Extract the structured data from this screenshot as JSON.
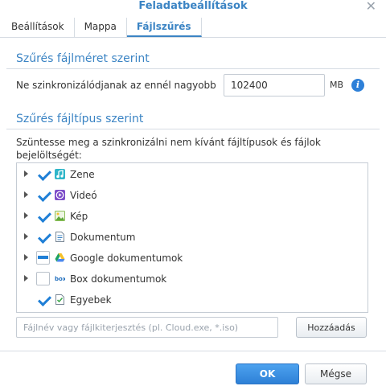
{
  "dialog": {
    "title": "Feladatbeállítások"
  },
  "tabs": [
    {
      "label": "Beállítások",
      "active": false
    },
    {
      "label": "Mappa",
      "active": false
    },
    {
      "label": "Fájlszűrés",
      "active": true
    }
  ],
  "size_section": {
    "title": "Szűrés fájlméret szerint",
    "label": "Ne szinkronizálódjanak az ennél nagyobb",
    "value": "102400",
    "unit": "MB"
  },
  "type_section": {
    "title": "Szűrés fájltípus szerint",
    "description": "Szüntesse meg a szinkronizálni nem kívánt fájltípusok és fájlok bejelöltségét:",
    "items": [
      {
        "label": "Zene",
        "state": "checked",
        "expandable": true,
        "icon": "music-icon"
      },
      {
        "label": "Videó",
        "state": "checked",
        "expandable": true,
        "icon": "video-icon"
      },
      {
        "label": "Kép",
        "state": "checked",
        "expandable": true,
        "icon": "image-icon"
      },
      {
        "label": "Dokumentum",
        "state": "checked",
        "expandable": true,
        "icon": "document-icon"
      },
      {
        "label": "Google dokumentumok",
        "state": "partial",
        "expandable": true,
        "icon": "google-drive-icon"
      },
      {
        "label": "Box dokumentumok",
        "state": "unchecked",
        "expandable": true,
        "icon": "box-icon"
      },
      {
        "label": "Egyebek",
        "state": "checked",
        "expandable": false,
        "icon": "other-files-icon"
      }
    ]
  },
  "filter": {
    "placeholder": "Fájlnév vagy fájlkiterjesztés (pl. Cloud.exe, *.iso)",
    "add_label": "Hozzáadás"
  },
  "footer": {
    "ok_label": "OK",
    "cancel_label": "Mégse"
  },
  "colors": {
    "accent": "#3b84c4",
    "checkbox": "#1f7fd6",
    "primary_button": "#2d80d6"
  }
}
